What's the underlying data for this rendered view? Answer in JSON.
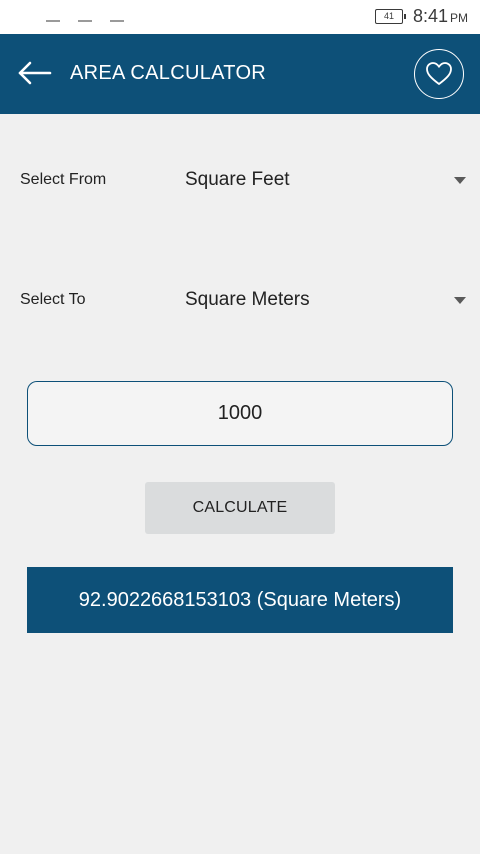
{
  "status_bar": {
    "battery_level": "41",
    "time": "8:41",
    "period": "PM"
  },
  "app_bar": {
    "title": "AREA CALCULATOR",
    "back_icon": "arrow-left-icon",
    "favorite_icon": "heart-icon",
    "background_color": "#0d5078"
  },
  "form": {
    "from_label": "Select From",
    "from_value": "Square Feet",
    "to_label": "Select To",
    "to_value": "Square Meters",
    "input_value": "1000",
    "calculate_label": "CALCULATE"
  },
  "result": {
    "text": "92.9022668153103 (Square Meters)"
  }
}
